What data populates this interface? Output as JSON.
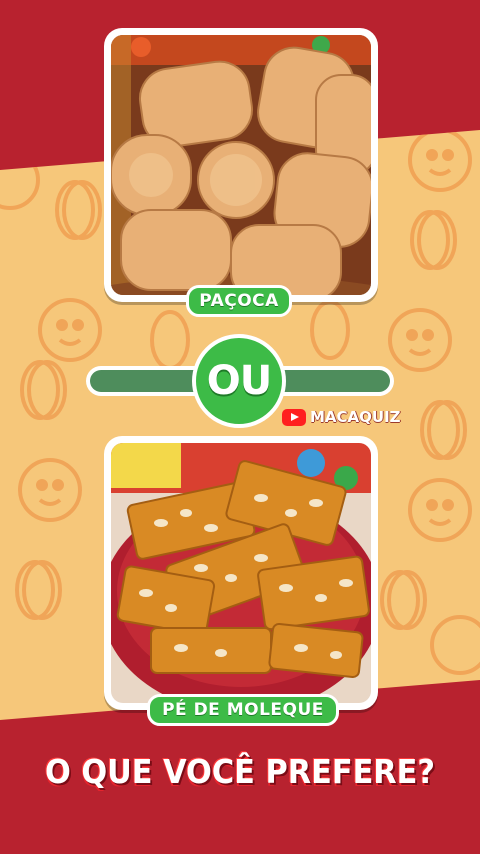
{
  "colors": {
    "background": "#b8222f",
    "band": "#f6c77a",
    "pattern": "#ef9a4d",
    "accent_green": "#3dbb47",
    "bar_green": "#4e8d5c",
    "white": "#ffffff",
    "youtube_red": "#ff1f1f"
  },
  "options": [
    {
      "label": "PAÇOCA",
      "image": "pacoca-photo"
    },
    {
      "label": "PÉ DE MOLEQUE",
      "image": "pe-de-moleque-photo"
    }
  ],
  "divider": {
    "label": "OU"
  },
  "brand": {
    "icon": "youtube-icon",
    "label": "MACAQUIZ"
  },
  "question": "O QUE VOCÊ PREFERE?",
  "background_pattern": {
    "icons": [
      "monkey-logo-icon",
      "coin-icon"
    ]
  }
}
